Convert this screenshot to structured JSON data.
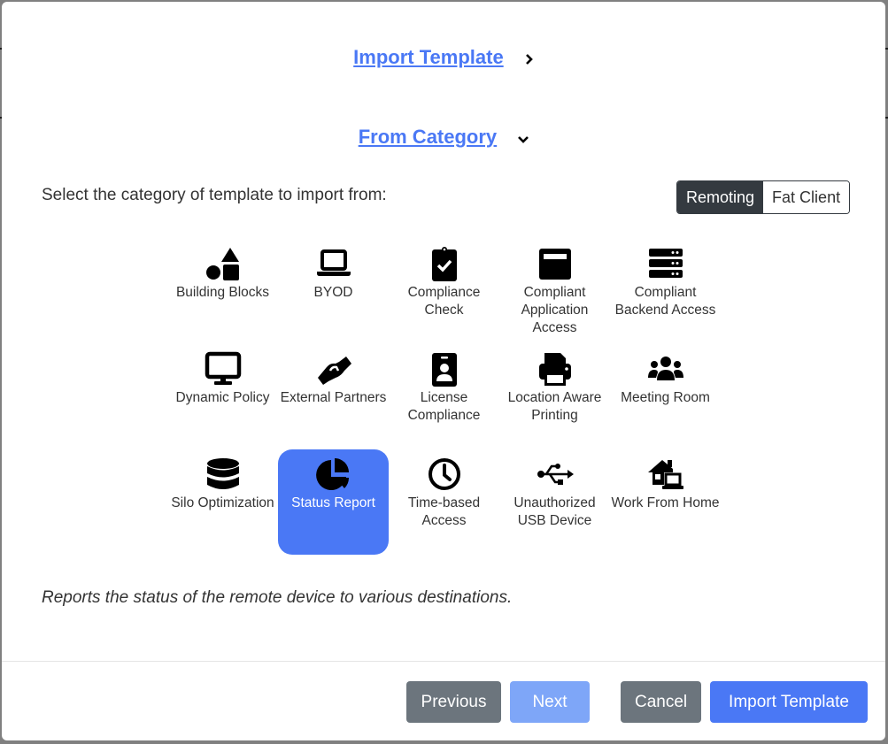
{
  "wizard": {
    "step1": {
      "label": "Import Template",
      "chevron": "chevron-right-icon"
    },
    "step2": {
      "label": "From Category",
      "chevron": "chevron-down-icon"
    }
  },
  "prompt": "Select the category of template to import from:",
  "mode_toggle": {
    "options": [
      "Remoting",
      "Fat Client"
    ],
    "selected": "Remoting"
  },
  "categories": [
    {
      "label": "Building Blocks",
      "icon": "shapes-icon"
    },
    {
      "label": "BYOD",
      "icon": "laptop-icon"
    },
    {
      "label": "Compliance Check",
      "icon": "clipboard-check-icon"
    },
    {
      "label": "Compliant Application Access",
      "icon": "window-icon"
    },
    {
      "label": "Compliant Backend Access",
      "icon": "server-icon"
    },
    {
      "label": "Dynamic Policy",
      "icon": "desktop-icon"
    },
    {
      "label": "External Partners",
      "icon": "handshake-icon"
    },
    {
      "label": "License Compliance",
      "icon": "id-badge-icon"
    },
    {
      "label": "Location Aware Printing",
      "icon": "printer-icon"
    },
    {
      "label": "Meeting Room",
      "icon": "users-icon"
    },
    {
      "label": "Silo Optimization",
      "icon": "database-icon"
    },
    {
      "label": "Status Report",
      "icon": "pie-chart-icon"
    },
    {
      "label": "Time-based Access",
      "icon": "clock-icon"
    },
    {
      "label": "Unauthorized USB Device",
      "icon": "usb-icon"
    },
    {
      "label": "Work From Home",
      "icon": "house-laptop-icon"
    }
  ],
  "selected_category": "Status Report",
  "description": "Reports the status of the remote device to various destinations.",
  "footer": {
    "previous": "Previous",
    "next": "Next",
    "cancel": "Cancel",
    "import": "Import Template"
  },
  "colors": {
    "accent": "#4a78f5",
    "secondary": "#6c757d",
    "disabled": "#7ea6f8",
    "toggle_active": "#343a40"
  }
}
